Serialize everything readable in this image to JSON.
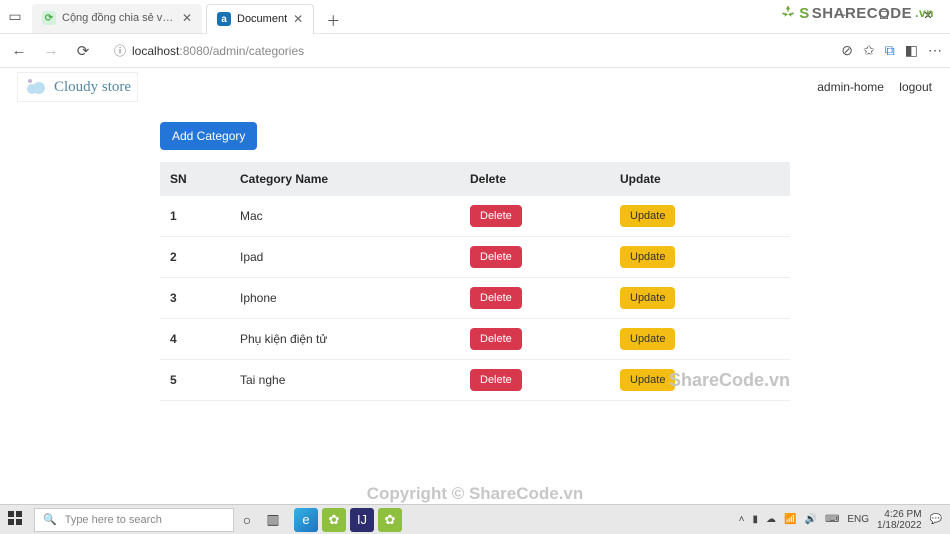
{
  "browser": {
    "tabs": [
      {
        "label": "Cộng đồng chia sẻ và download",
        "active": false
      },
      {
        "label": "Document",
        "active": true
      }
    ],
    "url_host": "localhost",
    "url_port": ":8080",
    "url_path": "/admin/categories"
  },
  "watermark": {
    "brand": "SHARECODE",
    "suffix": ".vn"
  },
  "header": {
    "logo_text": "Cloudy store",
    "links": {
      "home": "admin-home",
      "logout": "logout"
    }
  },
  "page": {
    "add_label": "Add Category",
    "columns": {
      "sn": "SN",
      "name": "Category Name",
      "del": "Delete",
      "upd": "Update"
    },
    "rows": [
      {
        "sn": "1",
        "name": "Mac"
      },
      {
        "sn": "2",
        "name": "Ipad"
      },
      {
        "sn": "3",
        "name": "Iphone"
      },
      {
        "sn": "4",
        "name": "Phụ kiện điện tử"
      },
      {
        "sn": "5",
        "name": "Tai nghe"
      }
    ],
    "btn_delete": "Delete",
    "btn_update": "Update"
  },
  "footer": {
    "mid_wm": "ShareCode.vn",
    "bottom_wm": "Copyright © ShareCode.vn"
  },
  "taskbar": {
    "search_placeholder": "Type here to search",
    "lang": "ENG",
    "time": "4:26 PM",
    "date": "1/18/2022"
  }
}
